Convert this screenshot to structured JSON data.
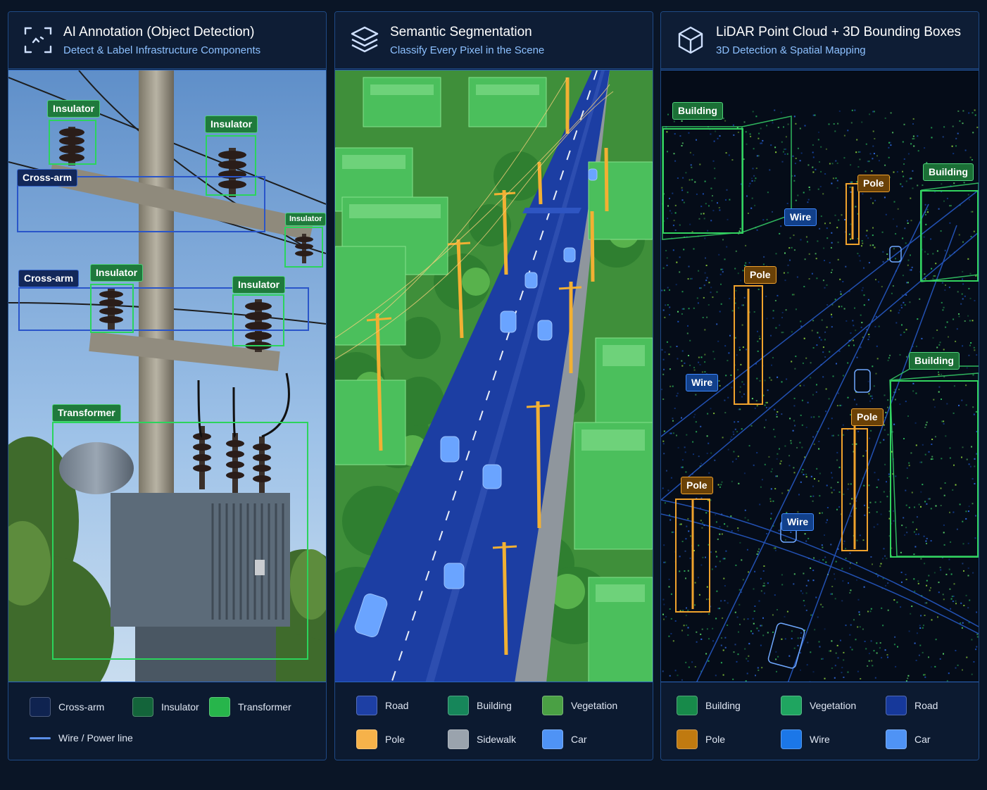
{
  "panels": [
    {
      "title": "AI Annotation (Object Detection)",
      "subtitle": "Detect & Label Infrastructure Components",
      "icon": "scan-icon",
      "labels": {
        "insulator_1": "Insulator",
        "insulator_2": "Insulator",
        "insulator_3": "Insulator",
        "insulator_4": "Insulator",
        "insulator_5": "Insulator",
        "crossarm_1": "Cross-arm",
        "crossarm_2": "Cross-arm",
        "transformer": "Transformer"
      },
      "legend": [
        {
          "label": "Cross-arm",
          "color": "#0f2350"
        },
        {
          "label": "Insulator",
          "color": "#13643a"
        },
        {
          "label": "Transformer",
          "color": "#27b54b"
        },
        {
          "label": "Wire / Power line",
          "color": "#5a8ee6",
          "style": "line"
        }
      ]
    },
    {
      "title": "Semantic Segmentation",
      "subtitle": "Classify Every Pixel in the Scene",
      "icon": "layers-icon",
      "legend": [
        {
          "label": "Road",
          "color": "#1d3fa4"
        },
        {
          "label": "Building",
          "color": "#16865a"
        },
        {
          "label": "Vegetation",
          "color": "#4aa044"
        },
        {
          "label": "Pole",
          "color": "#f6b24a"
        },
        {
          "label": "Sidewalk",
          "color": "#9aa3ad"
        },
        {
          "label": "Car",
          "color": "#4f93f5"
        }
      ]
    },
    {
      "title": "LiDAR Point Cloud + 3D Bounding Boxes",
      "subtitle": "3D Detection & Spatial Mapping",
      "icon": "cube-icon",
      "labels": {
        "building_1": "Building",
        "building_2": "Building",
        "building_3": "Building",
        "pole_1": "Pole",
        "pole_2": "Pole",
        "pole_3": "Pole",
        "pole_4": "Pole",
        "wire_1": "Wire",
        "wire_2": "Wire",
        "wire_3": "Wire"
      },
      "legend": [
        {
          "label": "Building",
          "color": "#178a4a"
        },
        {
          "label": "Vegetation",
          "color": "#1fa560"
        },
        {
          "label": "Road",
          "color": "#16389a"
        },
        {
          "label": "Pole",
          "color": "#c07a10"
        },
        {
          "label": "Wire",
          "color": "#1b77e8"
        },
        {
          "label": "Car",
          "color": "#4f93f5"
        }
      ]
    }
  ]
}
